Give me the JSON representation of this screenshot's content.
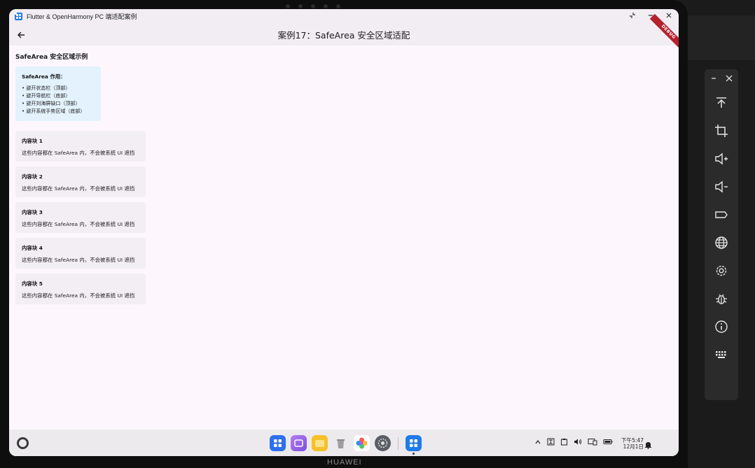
{
  "window": {
    "title": "Flutter & OpenHarmony PC 端适配案例",
    "controls": [
      "restore",
      "minimize",
      "close"
    ]
  },
  "appbar": {
    "title": "案例17：SafeArea 安全区域适配",
    "debug_label": "DEBUG"
  },
  "main": {
    "section_title": "SafeArea 安全区域示例",
    "info_card": {
      "heading": "SafeArea 作用：",
      "items": [
        "• 避开状态栏（顶部）",
        "• 避开导航栏（底部）",
        "• 避开刘海屏缺口（顶部）",
        "• 避开系统手势区域（底部）"
      ]
    },
    "blocks": [
      {
        "title": "内容块 1",
        "body": "这些内容都在 SafeArea 内，不会被系统 UI 遮挡"
      },
      {
        "title": "内容块 2",
        "body": "这些内容都在 SafeArea 内，不会被系统 UI 遮挡"
      },
      {
        "title": "内容块 3",
        "body": "这些内容都在 SafeArea 内，不会被系统 UI 遮挡"
      },
      {
        "title": "内容块 4",
        "body": "这些内容都在 SafeArea 内，不会被系统 UI 遮挡"
      },
      {
        "title": "内容块 5",
        "body": "这些内容都在 SafeArea 内，不会被系统 UI 遮挡"
      }
    ]
  },
  "taskbar": {
    "dock_apps": [
      "app-center-icon",
      "multitask-icon",
      "files-icon",
      "trash-icon",
      "gallery-icon",
      "settings-icon",
      "flutter-app-icon"
    ],
    "tray_icons": [
      "chevron-up-icon",
      "ime-icon",
      "clipboard-icon",
      "volume-icon",
      "display-icon",
      "battery-icon"
    ],
    "clock": {
      "time": "下午5:47",
      "date": "12月1日"
    }
  },
  "device": {
    "brand": "HUAWEI"
  },
  "side_panel": {
    "top_controls": [
      "minimize-icon",
      "close-icon"
    ],
    "buttons": [
      "to-top-icon",
      "crop-icon",
      "volume-up-icon",
      "volume-down-icon",
      "tag-icon",
      "globe-icon",
      "settings-icon",
      "bug-icon",
      "info-icon",
      "keyboard-icon"
    ]
  },
  "colors": {
    "accent": "#1f7aec",
    "info_card_bg": "#e3f2fd",
    "block_bg": "#f3eef4",
    "page_bg": "#fdf7fd",
    "debug_ribbon": "#b7202e"
  }
}
